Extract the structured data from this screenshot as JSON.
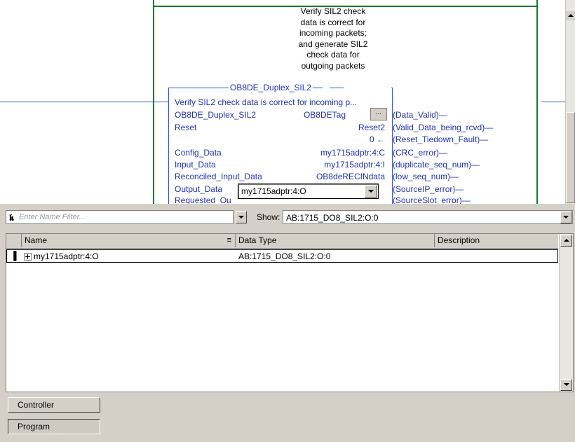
{
  "ladder": {
    "rung_comment_lines": [
      "Verify SIL2 check",
      "data is correct for",
      "incoming packets;",
      "and generate SIL2",
      "check data for",
      "outgoing packets"
    ],
    "aoi": {
      "title": "OB8DE_Duplex_SIL2",
      "description": "Verify SIL2 check data is correct for incoming p...",
      "rows": [
        {
          "label": "OB8DE_Duplex_SIL2",
          "value": "OB8DETag"
        },
        {
          "label": "Reset",
          "value": "Reset2"
        },
        {
          "label": "",
          "value": "0 ←"
        },
        {
          "label": "Config_Data",
          "value": "my1715adptr:4:C"
        },
        {
          "label": "Input_Data",
          "value": "my1715adptr:4:I"
        },
        {
          "label": "Reconciled_Input_Data",
          "value": "OB8deRECINdata"
        },
        {
          "label": "Output_Data",
          "value": ""
        },
        {
          "label": "Requested_Ou",
          "value": ""
        }
      ],
      "ellipsis_label": "...",
      "outputs": [
        "(Data_Valid)",
        "(Valid_Data_being_rcvd)",
        "(Reset_Tiedown_Fault)",
        "(CRC_error)",
        "(duplicate_seq_num)",
        "(low_seq_num)",
        "(SourceIP_error)",
        "(SourceSlot_error)"
      ]
    },
    "tag_combo_value": "my1715adptr:4:O"
  },
  "filter": {
    "placeholder": "Enter Name Filter...",
    "show_label": "Show:",
    "show_value": "AB:1715_DO8_SIL2:O:0"
  },
  "table": {
    "columns": [
      "Name",
      "Data Type",
      "Description"
    ],
    "rows": [
      {
        "name": "my1715adptr:4:O",
        "data_type": "AB:1715_DO8_SIL2:O:0",
        "description": ""
      }
    ]
  },
  "scope": {
    "controller_label": "Controller",
    "program_label": "Program"
  }
}
